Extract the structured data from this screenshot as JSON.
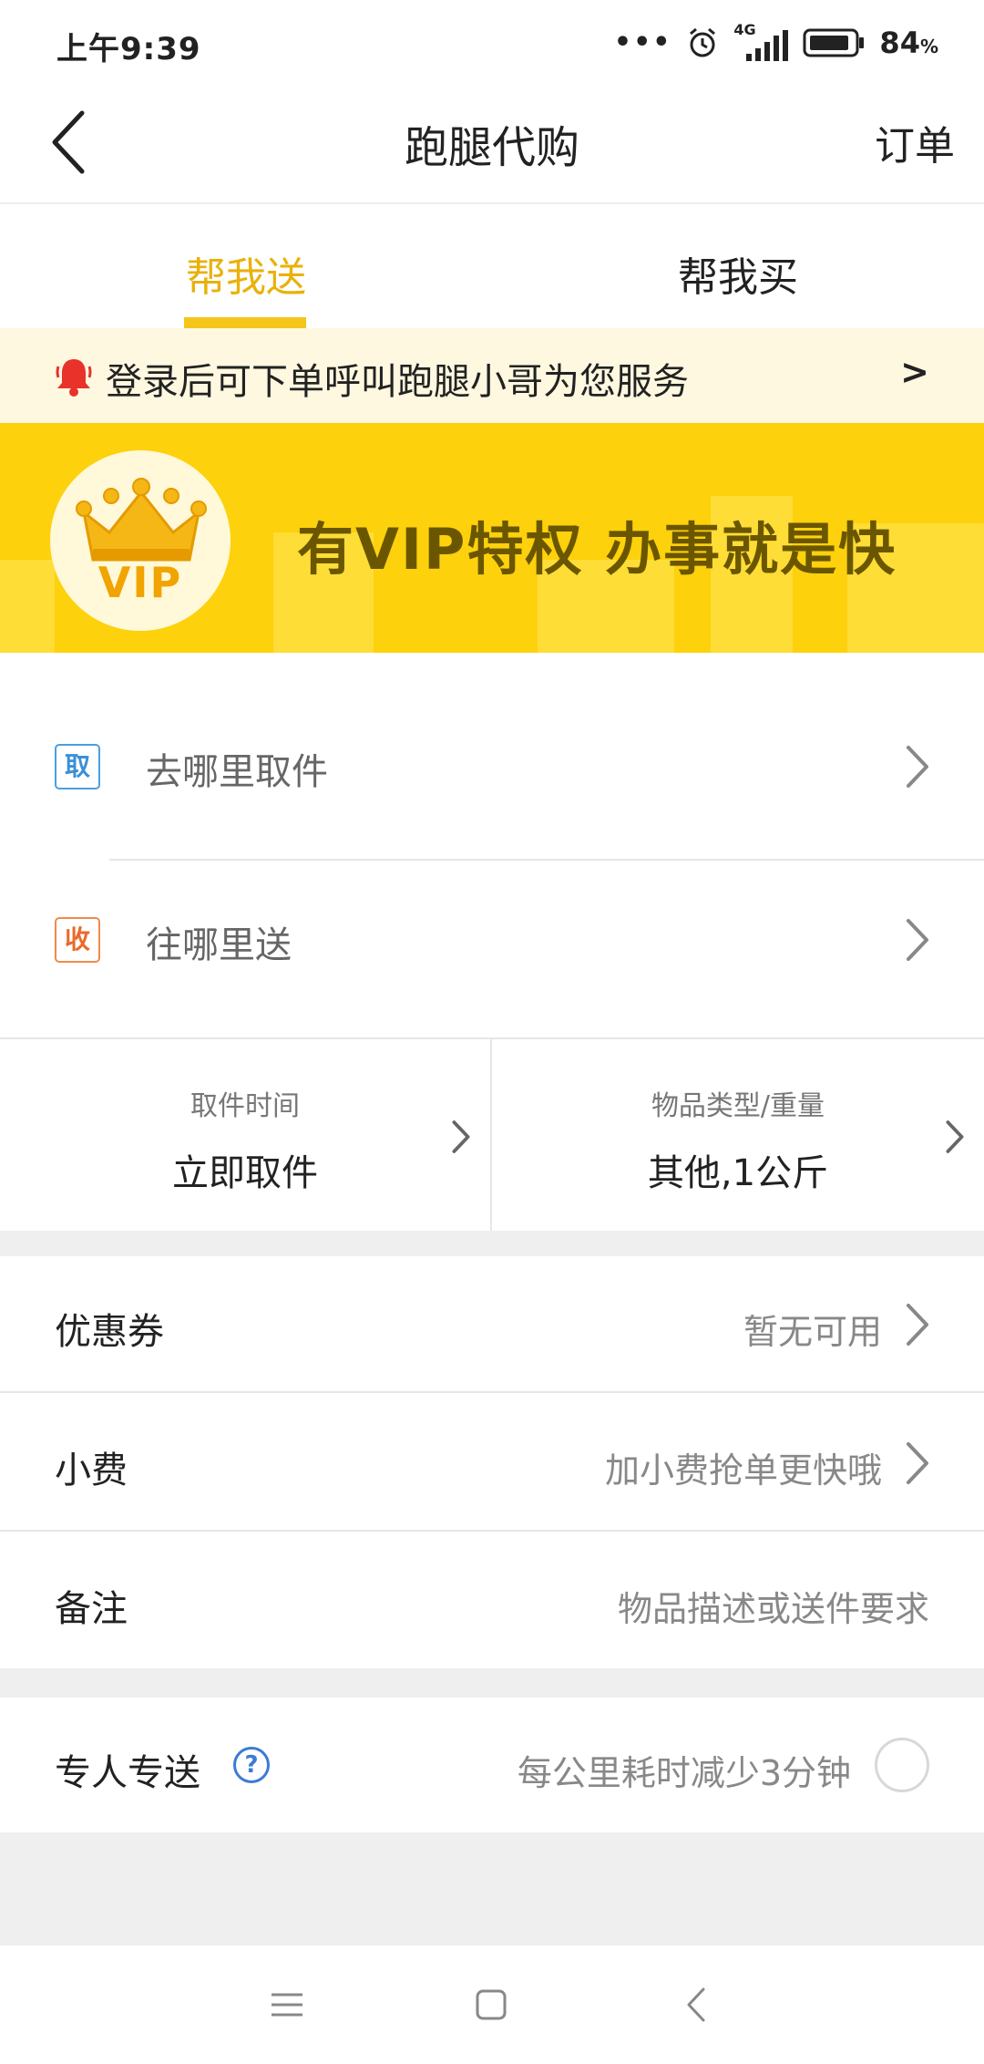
{
  "status_bar": {
    "time": "上午9:39",
    "dots": "•••",
    "network": "4G",
    "battery_percent": "84",
    "battery_unit": "%"
  },
  "nav": {
    "title": "跑腿代购",
    "orders": "订单",
    "back_icon": "chevron-left-icon"
  },
  "tabs": [
    {
      "label": "帮我送",
      "active": true
    },
    {
      "label": "帮我买",
      "active": false
    }
  ],
  "notice": {
    "text": "登录后可下单呼叫跑腿小哥为您服务",
    "arrow": ">"
  },
  "vip_banner": {
    "badge": "VIP",
    "slogan": "有VIP特权 办事就是快"
  },
  "address": {
    "pickup": {
      "badge": "取",
      "placeholder": "去哪里取件"
    },
    "deliver": {
      "badge": "收",
      "placeholder": "往哪里送"
    }
  },
  "info": {
    "pickup_time": {
      "label": "取件时间",
      "value": "立即取件"
    },
    "item_type": {
      "label": "物品类型/重量",
      "value": "其他,1公斤"
    }
  },
  "options": [
    {
      "label": "优惠券",
      "value": "暂无可用",
      "arrow": true
    },
    {
      "label": "小费",
      "value": "加小费抢单更快哦",
      "arrow": true
    },
    {
      "label": "备注",
      "value": "物品描述或送件要求",
      "arrow": false
    }
  ],
  "dedicated": {
    "label": "专人专送",
    "help": "?",
    "hint": "每公里耗时减少3分钟"
  },
  "colors": {
    "accent": "#f5c51a",
    "accent_text": "#e9b10a",
    "notice_bg": "#fff8e0",
    "banner_bg": "#fdd10c",
    "pickup_blue": "#3a8fd8",
    "deliver_orange": "#ea6a2a"
  }
}
